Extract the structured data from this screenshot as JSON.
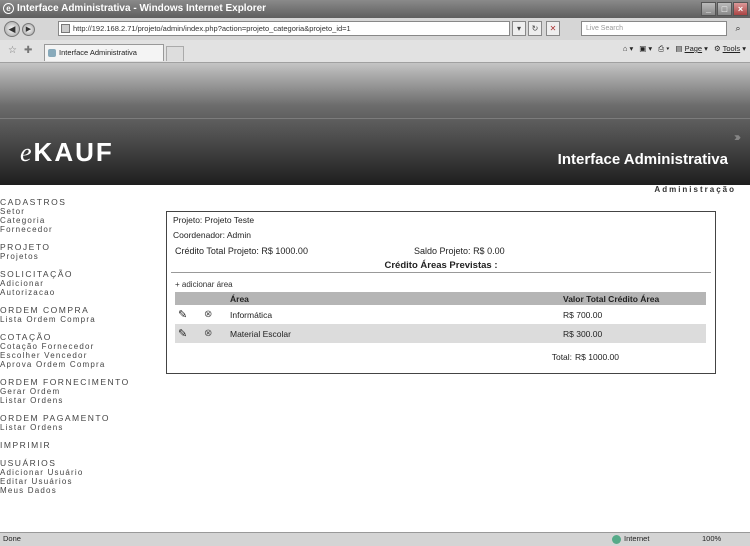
{
  "browser": {
    "title": "Interface Administrativa - Windows Internet Explorer",
    "url": "http://192.168.2.71/projeto/admin/index.php?action=projeto_categoria&projeto_id=1",
    "search_placeholder": "Live Search",
    "tab_title": "Interface Administrativa",
    "page_menu": "Page",
    "tools_menu": "Tools",
    "status_left": "Done",
    "status_zone": "Internet",
    "zoom": "100%"
  },
  "header": {
    "logo_prefix": "e",
    "logo_rest": "KAUF",
    "title": "Interface Administrativa",
    "subtitle": "Administração"
  },
  "sidebar": {
    "groups": [
      {
        "title": "CADASTROS",
        "items": [
          "Setor",
          "Categoria",
          "Fornecedor"
        ]
      },
      {
        "title": "PROJETO",
        "items": [
          "Projetos"
        ]
      },
      {
        "title": "SOLICITAÇÃO",
        "items": [
          "Adicionar",
          "Autorizacao"
        ]
      },
      {
        "title": "ORDEM COMPRA",
        "items": [
          "Lista Ordem Compra"
        ]
      },
      {
        "title": "COTAÇÃO",
        "items": [
          "Cotação Fornecedor",
          "Escolher Vencedor",
          "Aprova Ordem Compra"
        ]
      },
      {
        "title": "ORDEM FORNECIMENTO",
        "items": [
          "Gerar Ordem",
          "Listar Ordens"
        ]
      },
      {
        "title": "ORDEM PAGAMENTO",
        "items": [
          "Listar Ordens"
        ]
      },
      {
        "title": "IMPRIMIR",
        "items": []
      },
      {
        "title": "USUÁRIOS",
        "items": [
          "Adicionar Usuário",
          "Editar Usuários",
          "Meus Dados"
        ]
      }
    ]
  },
  "project": {
    "name_label": "Projeto:",
    "name": "Projeto Teste",
    "coord_label": "Coordenador:",
    "coord": "Admin",
    "credit_label": "Crédito Total Projeto:",
    "credit": "R$ 1000.00",
    "balance_label": "Saldo Projeto:",
    "balance": "R$ 0.00"
  },
  "areas": {
    "title": "Crédito Áreas Previstas :",
    "add_link": "+ adicionar área",
    "col_area": "Área",
    "col_value": "Valor Total Crédito Área",
    "rows": [
      {
        "area": "Informática",
        "value": "R$ 700.00"
      },
      {
        "area": "Material Escolar",
        "value": "R$ 300.00"
      }
    ],
    "total_label": "Total:",
    "total_value": "R$ 1000.00"
  }
}
